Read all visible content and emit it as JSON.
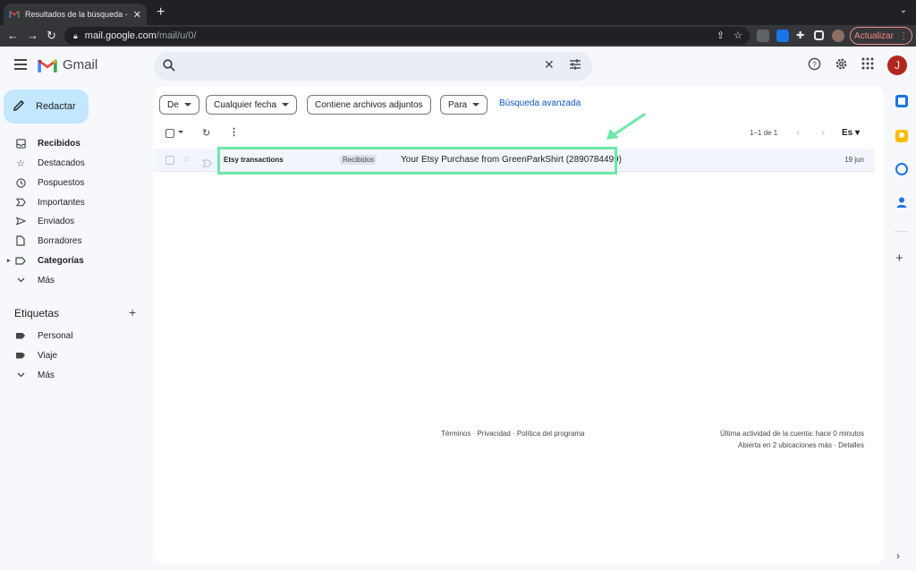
{
  "browser": {
    "tab_title": "Resultados de la búsqueda - ja",
    "url_host": "mail.google.com",
    "url_path": "/mail/u/0/",
    "update_label": "Actualizar"
  },
  "header": {
    "app_name": "Gmail",
    "search_placeholder": "",
    "avatar_letter": "J"
  },
  "sidebar": {
    "compose_label": "Redactar",
    "items": [
      {
        "label": "Recibidos",
        "icon": "inbox-icon"
      },
      {
        "label": "Destacados",
        "icon": "star-icon"
      },
      {
        "label": "Pospuestos",
        "icon": "clock-icon"
      },
      {
        "label": "Importantes",
        "icon": "important-icon"
      },
      {
        "label": "Enviados",
        "icon": "send-icon"
      },
      {
        "label": "Borradores",
        "icon": "draft-icon"
      },
      {
        "label": "Categorías",
        "icon": "label-icon"
      },
      {
        "label": "Más",
        "icon": "chevron-down-icon"
      }
    ],
    "labels_title": "Etiquetas",
    "labels": [
      {
        "label": "Personal"
      },
      {
        "label": "Viaje"
      },
      {
        "label": "Más"
      }
    ]
  },
  "filters": {
    "from": "De",
    "date": "Cualquier fecha",
    "attachments": "Contiene archivos adjuntos",
    "to": "Para",
    "advanced": "Búsqueda avanzada"
  },
  "toolbar": {
    "pagination": "1–1 de 1",
    "lang": "Es"
  },
  "email": {
    "sender": "Etsy transactions",
    "badge": "Recibidos",
    "subject": "Your Etsy Purchase from GreenParkShirt (2890784499)",
    "date": "19 jun"
  },
  "footer": {
    "links": "Términos · Privacidad · Política del programa",
    "activity": "Última actividad de la cuenta: hace 0 minutos",
    "sessions": "Abierta en 2 ubicaciones más · Detalles"
  },
  "colors": {
    "highlight": "#6ee7a8",
    "compose_bg": "#c2e7ff",
    "link": "#0b57d0"
  }
}
